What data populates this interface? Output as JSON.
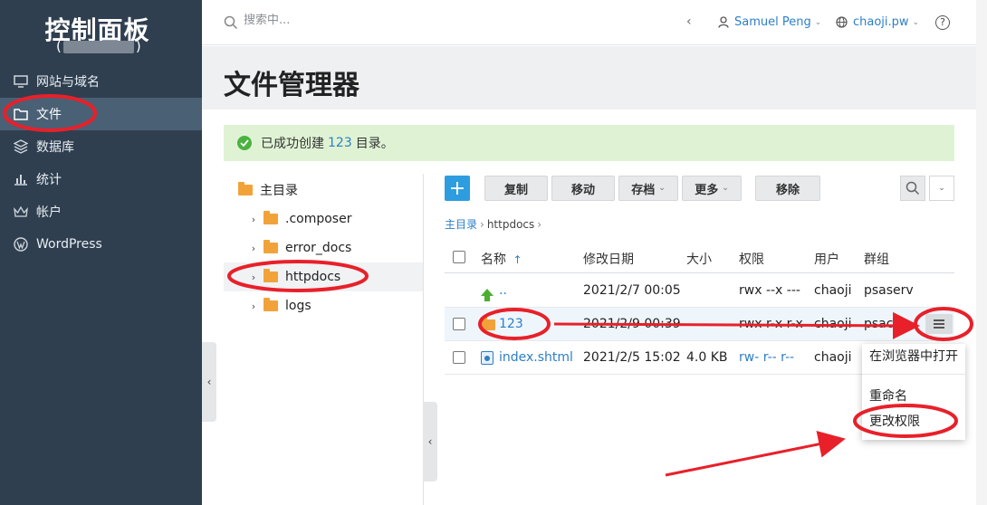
{
  "sidebar": {
    "title": "控制面板",
    "subtitle_left": "(",
    "subtitle_right": ")",
    "items": [
      {
        "label": "网站与域名",
        "icon": "monitor-icon"
      },
      {
        "label": "文件",
        "icon": "folder-icon",
        "active": true
      },
      {
        "label": "数据库",
        "icon": "database-icon"
      },
      {
        "label": "统计",
        "icon": "bar-chart-icon"
      },
      {
        "label": "帐户",
        "icon": "crown-icon"
      },
      {
        "label": "WordPress",
        "icon": "wordpress-icon"
      }
    ]
  },
  "topbar": {
    "search_placeholder": "搜索中...",
    "user": "Samuel Peng",
    "domain": "chaoji.pw"
  },
  "page": {
    "title": "文件管理器"
  },
  "banner": {
    "prefix": "已成功创建",
    "link": "123",
    "suffix": "目录。"
  },
  "tree": {
    "root": "主目录",
    "items": [
      {
        "label": ".composer"
      },
      {
        "label": "error_docs"
      },
      {
        "label": "httpdocs",
        "selected": true
      },
      {
        "label": "logs"
      }
    ]
  },
  "toolbar": {
    "add": "+",
    "copy": "复制",
    "move": "移动",
    "archive": "存档",
    "more": "更多",
    "remove": "移除"
  },
  "breadcrumb": {
    "home": "主目录",
    "current": "httpdocs"
  },
  "table": {
    "columns": {
      "name": "名称",
      "sort_indicator": "↑",
      "modified": "修改日期",
      "size": "大小",
      "perms": "权限",
      "user": "用户",
      "group": "群组"
    },
    "rows": [
      {
        "name": "..",
        "modified": "2021/2/7 00:05",
        "size": "",
        "perms": "rwx --x ---",
        "user": "chaoji",
        "group": "psaserv"
      },
      {
        "name": "123",
        "modified": "2021/2/9 00:39",
        "size": "",
        "perms": "rwx r-x r-x",
        "user": "chaoji",
        "group": "psacln"
      },
      {
        "name": "index.shtml",
        "modified": "2021/2/5 15:02",
        "size": "4.0 KB",
        "perms": "rw- r-- r--",
        "user": "chaoji",
        "group": ""
      }
    ]
  },
  "context_menu": {
    "open_in_browser": "在浏览器中打开",
    "rename": "重命名",
    "change_perms": "更改权限"
  },
  "colors": {
    "sidebar_bg": "#2f3f50",
    "accent_blue": "#2d7fc6",
    "success_bg": "#dff3d4",
    "annotation_red": "#e8202a"
  }
}
